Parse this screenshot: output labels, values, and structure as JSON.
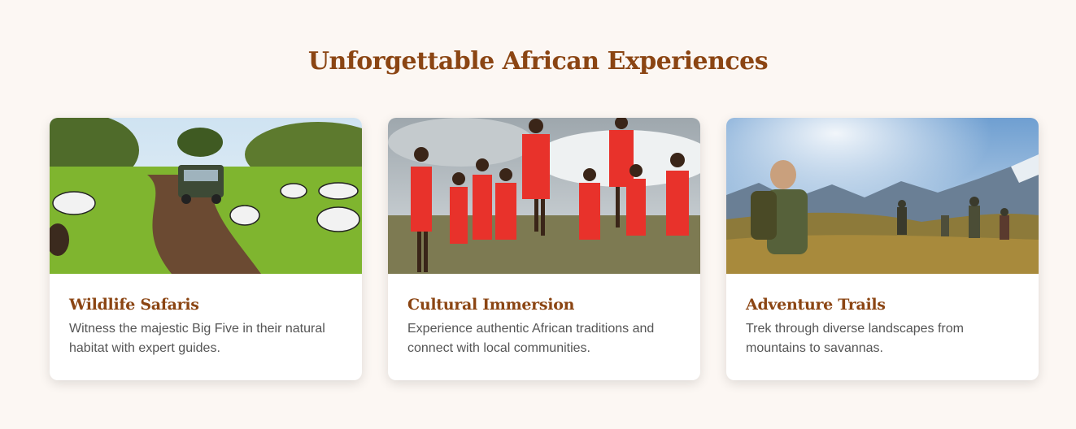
{
  "section": {
    "title": "Unforgettable African Experiences"
  },
  "cards": [
    {
      "title": "Wildlife Safaris",
      "text": "Witness the majestic Big Five in their natural habitat with expert guides.",
      "image": "zebras-and-safari-jeep-photo"
    },
    {
      "title": "Cultural Immersion",
      "text": "Experience authentic African traditions and connect with local communities.",
      "image": "maasai-jumping-dance-photo"
    },
    {
      "title": "Adventure Trails",
      "text": "Trek through diverse landscapes from mountains to savannas.",
      "image": "hikers-in-mountains-photo"
    }
  ],
  "colors": {
    "background": "#fcf7f3",
    "accent": "#8b4513",
    "body_text": "#555555"
  }
}
